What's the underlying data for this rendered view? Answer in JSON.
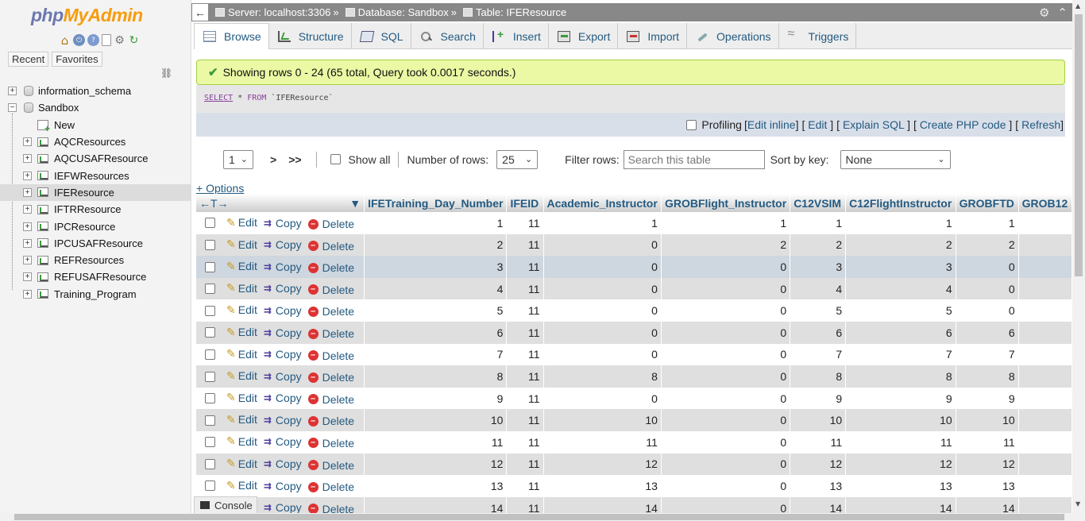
{
  "nav": {
    "logo_part1": "php",
    "logo_part2": "MyAdmin",
    "tabs": [
      "Recent",
      "Favorites"
    ],
    "databases": [
      {
        "name": "information_schema",
        "expander": "+"
      },
      {
        "name": "Sandbox",
        "expander": "−"
      }
    ],
    "new_label": "New",
    "tables": [
      "AQCResources",
      "AQCUSAFResource",
      "IEFWResources",
      "IFEResource",
      "IFTRResource",
      "IPCResource",
      "IPCUSAFResource",
      "REFResources",
      "REFUSAFResource",
      "Training_Program"
    ],
    "selected_table": "IFEResource"
  },
  "breadcrumb": {
    "server": "Server: localhost:3306",
    "database": "Database: Sandbox",
    "table": "Table: IFEResource",
    "sep": "»"
  },
  "tabs": [
    "Browse",
    "Structure",
    "SQL",
    "Search",
    "Insert",
    "Export",
    "Import",
    "Operations",
    "Triggers"
  ],
  "active_tab": "Browse",
  "message": "Showing rows 0 - 24 (65 total, Query took 0.0017 seconds.)",
  "sql": {
    "kw1": "SELECT",
    "star": " * ",
    "kw2": "FROM",
    "table": " `IFEResource`"
  },
  "profiling": {
    "label": "Profiling",
    "links": [
      "Edit inline",
      "Edit",
      "Explain SQL",
      "Create PHP code",
      "Refresh"
    ]
  },
  "pagination": {
    "page": "1",
    "next": ">",
    "last": ">>",
    "show_all": "Show all",
    "rows_label": "Number of rows:",
    "rows_value": "25",
    "filter_label": "Filter rows:",
    "filter_placeholder": "Search this table",
    "sort_label": "Sort by key:",
    "sort_value": "None"
  },
  "options_link": "+ Options",
  "columns": [
    "IFETraining_Day_Number",
    "IFEID",
    "Academic_Instructor",
    "GROBFlight_Instructor",
    "C12VSIM",
    "C12FlightInstructor",
    "GROBFTD",
    "GROB12"
  ],
  "row_actions": {
    "edit": "Edit",
    "copy": "Copy",
    "delete": "Delete"
  },
  "rows": [
    [
      "1",
      "11",
      "1",
      "1",
      "1",
      "1",
      "1"
    ],
    [
      "2",
      "11",
      "0",
      "2",
      "2",
      "2",
      "2"
    ],
    [
      "3",
      "11",
      "0",
      "0",
      "3",
      "3",
      "0"
    ],
    [
      "4",
      "11",
      "0",
      "0",
      "4",
      "4",
      "0"
    ],
    [
      "5",
      "11",
      "0",
      "0",
      "5",
      "5",
      "0"
    ],
    [
      "6",
      "11",
      "0",
      "0",
      "6",
      "6",
      "6"
    ],
    [
      "7",
      "11",
      "0",
      "0",
      "7",
      "7",
      "7"
    ],
    [
      "8",
      "11",
      "8",
      "0",
      "8",
      "8",
      "8"
    ],
    [
      "9",
      "11",
      "0",
      "0",
      "9",
      "9",
      "9"
    ],
    [
      "10",
      "11",
      "10",
      "0",
      "10",
      "10",
      "10"
    ],
    [
      "11",
      "11",
      "11",
      "0",
      "11",
      "11",
      "11"
    ],
    [
      "12",
      "11",
      "12",
      "0",
      "12",
      "12",
      "12"
    ],
    [
      "13",
      "11",
      "13",
      "0",
      "13",
      "13",
      "13"
    ],
    [
      "14",
      "11",
      "14",
      "0",
      "14",
      "14",
      "14"
    ]
  ],
  "highlighted_row": 2,
  "console_label": "Console"
}
